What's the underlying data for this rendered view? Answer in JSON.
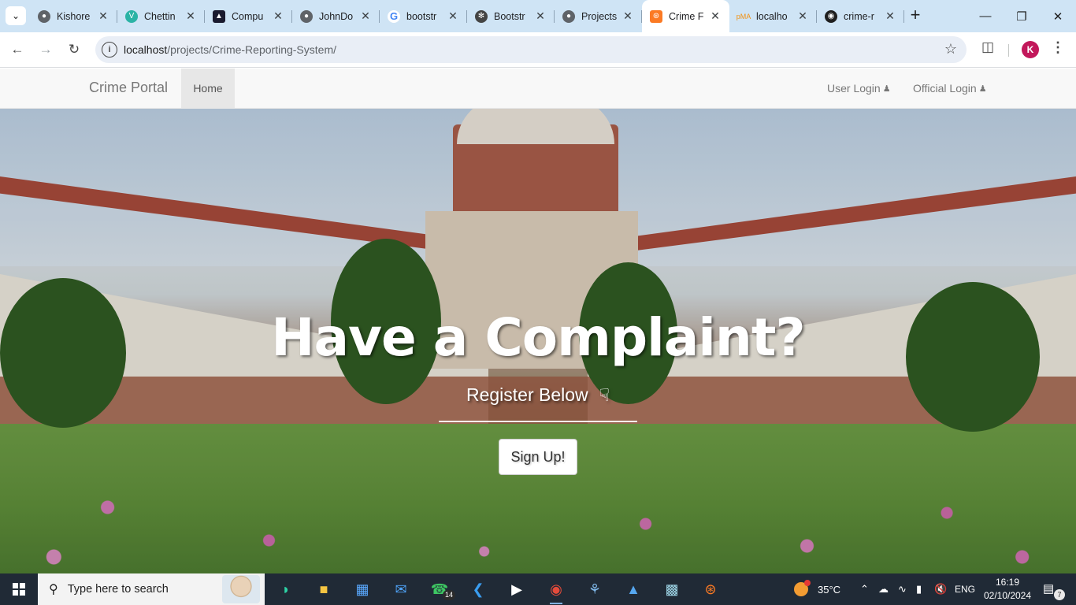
{
  "browser": {
    "tabs": [
      {
        "title": "Kishore",
        "favicon": "globe-icon",
        "color": "#5f6368"
      },
      {
        "title": "Chettin",
        "favicon": "v-logo-icon",
        "color": "#2bb3a5"
      },
      {
        "title": "Compu",
        "favicon": "graduation-cap-icon",
        "color": "#1a1a2e"
      },
      {
        "title": "JohnDo",
        "favicon": "globe-icon",
        "color": "#5f6368"
      },
      {
        "title": "bootstr",
        "favicon": "google-icon",
        "color": "#4285f4"
      },
      {
        "title": "Bootstr",
        "favicon": "openai-icon",
        "color": "#444444"
      },
      {
        "title": "Projects",
        "favicon": "globe-icon",
        "color": "#5f6368"
      },
      {
        "title": "Crime F",
        "favicon": "xampp-icon",
        "color": "#fb7a24",
        "active": true
      },
      {
        "title": "localho",
        "favicon": "phpmyadmin-icon",
        "color": "#f29111"
      },
      {
        "title": "crime-r",
        "favicon": "github-icon",
        "color": "#1f1f1f"
      }
    ],
    "url_host": "localhost",
    "url_path": "/projects/Crime-Reporting-System/",
    "profile_initial": "K"
  },
  "navbar": {
    "brand": "Crime Portal",
    "home": "Home",
    "user_login": "User Login",
    "official_login": "Official Login"
  },
  "hero": {
    "title": "Have a Complaint?",
    "subtitle": "Register Below",
    "signup": "Sign Up!"
  },
  "taskbar": {
    "search_placeholder": "Type here to search",
    "whatsapp_badge": "14",
    "temperature": "35°C",
    "language": "ENG",
    "time": "16:19",
    "date": "02/10/2024",
    "notification_count": "7"
  }
}
